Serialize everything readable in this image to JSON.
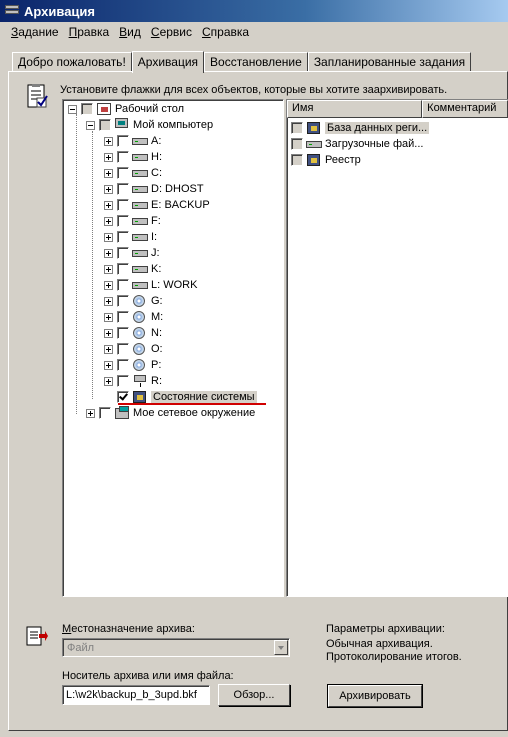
{
  "window": {
    "title": "Архивация"
  },
  "menu": [
    {
      "hot": "З",
      "rest": "адание"
    },
    {
      "hot": "П",
      "rest": "равка"
    },
    {
      "hot": "В",
      "rest": "ид"
    },
    {
      "hot": "С",
      "rest": "ервис"
    },
    {
      "hot": "С",
      "rest": "правка"
    }
  ],
  "tabs": [
    "Добро пожаловать!",
    "Архивация",
    "Восстановление",
    "Запланированные задания"
  ],
  "active_tab": "Архивация",
  "instruction": "Установите флажки для всех объектов, которые вы хотите заархивировать.",
  "tree": {
    "desktop": "Рабочий стол",
    "my_computer": "Мой компьютер",
    "drives": [
      "A:",
      "H:",
      "C:",
      "D: DHOST",
      "E: BACKUP",
      "F:",
      "I:",
      "J:",
      "K:",
      "L: WORK",
      "G:",
      "M:",
      "N:",
      "O:",
      "P:",
      "R:"
    ],
    "system_state": "Состояние системы",
    "network": "Мое сетевое окружение"
  },
  "list": {
    "columns": [
      "Имя",
      "Комментарий"
    ],
    "items": [
      "База данных реги...",
      "Загрузочные фай...",
      "Реестр"
    ]
  },
  "bottom": {
    "destination_label": "Местоназначение архива:",
    "destination_value": "Файл",
    "media_label": "Носитель архива или имя файла:",
    "media_value": "L:\\w2k\\backup_b_3upd.bkf",
    "browse_button": "Обзор...",
    "params_title": "Параметры архивации:",
    "params_line1": "Обычная архивация.",
    "params_line2": "Протоколирование итогов.",
    "start_button": "Архивировать"
  }
}
